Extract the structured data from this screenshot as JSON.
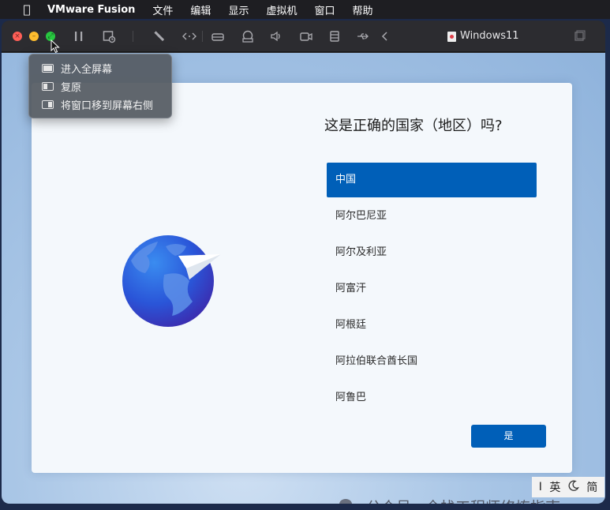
{
  "menubar": {
    "apple_icon": "apple-logo-icon",
    "app_name": "VMware Fusion",
    "items": [
      "文件",
      "编辑",
      "显示",
      "虚拟机",
      "窗口",
      "帮助"
    ]
  },
  "window": {
    "title": "Windows11",
    "toolbar_icons": [
      "pause-icon",
      "snapshot-icon",
      "wrench-icon",
      "code-arrows-icon",
      "drive-icon",
      "printer-icon",
      "speaker-icon",
      "camera-icon",
      "database-icon",
      "usb-icon",
      "chevron-left-icon",
      "windows-icon"
    ]
  },
  "popup_menu": {
    "items": [
      {
        "label": "进入全屏幕",
        "icon": "fullscreen-icon"
      },
      {
        "label": "复原",
        "icon": "restore-icon"
      },
      {
        "label": "将窗口移到屏幕右侧",
        "icon": "move-right-icon"
      }
    ]
  },
  "oobe": {
    "title": "这是正确的国家（地区）吗?",
    "countries": [
      "中国",
      "阿尔巴尼亚",
      "阿尔及利亚",
      "阿富汗",
      "阿根廷",
      "阿拉伯联合酋长国",
      "阿鲁巴"
    ],
    "selected_index": 0,
    "yes_button": "是"
  },
  "ime": {
    "cursor_mark": "I",
    "language": "英",
    "moon_icon": "moon-icon",
    "mode": "简"
  },
  "watermark": {
    "text": "公众号 · 全栈工程师修炼指南"
  },
  "colors": {
    "accent": "#005fb8",
    "menubar": "#1e1e22",
    "toolbar": "#2c2c30"
  }
}
